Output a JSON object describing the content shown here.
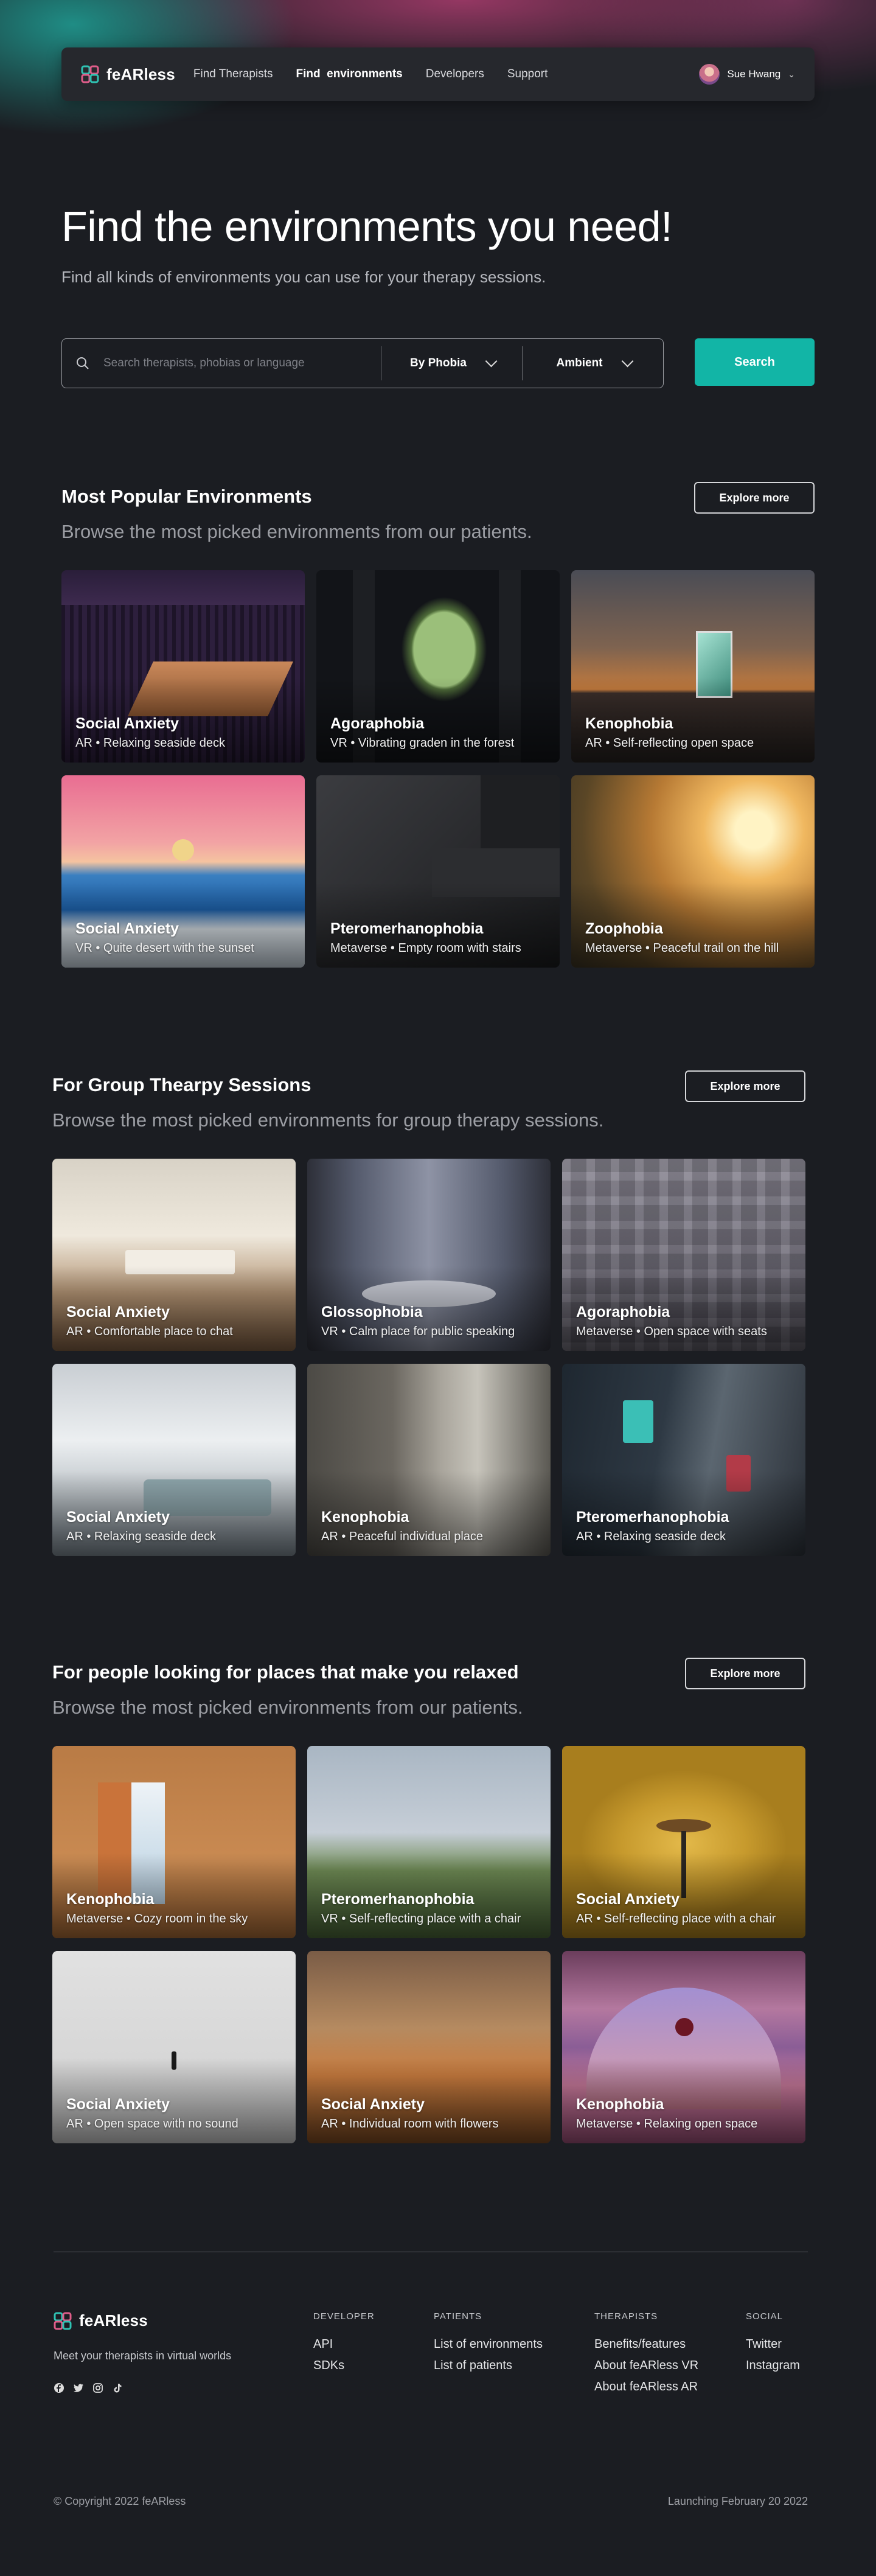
{
  "brand": {
    "name": "feARless",
    "accent": "#12b5a6"
  },
  "nav": {
    "links": [
      "Find Therapists",
      "Find  environments",
      "Developers",
      "Support"
    ],
    "active_index": 1,
    "user_name": "Sue Hwang",
    "user_chevron": "⌄"
  },
  "hero": {
    "title": "Find the environments you need!",
    "subtitle": "Find all kinds of environments you can use for your therapy sessions."
  },
  "search": {
    "placeholder": "Search therapists, phobias or language",
    "filter_phobia": "By Phobia",
    "filter_ambient": "Ambient",
    "button": "Search"
  },
  "sections": [
    {
      "title": "Most Popular Environments",
      "subtitle": "Browse the most picked environments from our patients.",
      "button": "Explore more",
      "cards": [
        {
          "title": "Social Anxiety",
          "meta": "AR • Relaxing seaside deck"
        },
        {
          "title": "Agoraphobia",
          "meta": "VR • Vibrating graden in the forest"
        },
        {
          "title": "Kenophobia",
          "meta": "AR • Self-reflecting open space"
        },
        {
          "title": "Social Anxiety",
          "meta": "VR • Quite desert with the sunset"
        },
        {
          "title": "Pteromerhanophobia",
          "meta": "Metaverse • Empty room with stairs"
        },
        {
          "title": "Zoophobia",
          "meta": "Metaverse • Peaceful trail on the hill"
        }
      ]
    },
    {
      "title": "For Group Thearpy Sessions",
      "subtitle": "Browse the most picked environments for group therapy sessions.",
      "button": "Explore more",
      "cards": [
        {
          "title": "Social Anxiety",
          "meta": "AR • Comfortable place to chat"
        },
        {
          "title": "Glossophobia",
          "meta": "VR • Calm place for public speaking"
        },
        {
          "title": "Agoraphobia",
          "meta": "Metaverse • Open space with seats"
        },
        {
          "title": "Social Anxiety",
          "meta": "AR • Relaxing seaside deck"
        },
        {
          "title": "Kenophobia",
          "meta": "AR • Peaceful individual place"
        },
        {
          "title": "Pteromerhanophobia",
          "meta": "AR • Relaxing seaside deck"
        }
      ]
    },
    {
      "title": "For people looking for places that make you relaxed",
      "subtitle": "Browse the most picked environments from our patients.",
      "button": "Explore more",
      "cards": [
        {
          "title": "Kenophobia",
          "meta": "Metaverse • Cozy room in the sky"
        },
        {
          "title": "Pteromerhanophobia",
          "meta": "VR • Self-reflecting place with a chair"
        },
        {
          "title": "Social Anxiety",
          "meta": "AR • Self-reflecting place with a chair"
        },
        {
          "title": "Social Anxiety",
          "meta": "AR •  Open space with no sound"
        },
        {
          "title": "Social Anxiety",
          "meta": "AR • Individual room with flowers"
        },
        {
          "title": "Kenophobia",
          "meta": "Metaverse • Relaxing open space"
        }
      ]
    }
  ],
  "footer": {
    "tagline": "Meet your therapists in virtual worlds",
    "social_icons": [
      "facebook-icon",
      "twitter-icon",
      "instagram-icon",
      "tiktok-icon"
    ],
    "columns": [
      {
        "heading": "DEVELOPER",
        "links": [
          "API",
          "SDKs"
        ]
      },
      {
        "heading": "PATIENTS",
        "links": [
          "List of environments",
          "List of patients"
        ]
      },
      {
        "heading": "THERAPISTS",
        "links": [
          "Benefits/features",
          "About feARless VR",
          "About feARless AR"
        ]
      },
      {
        "heading": "SOCIAL",
        "links": [
          "Twitter",
          "Instagram"
        ]
      }
    ],
    "copyright": "© Copyright 2022 feARless",
    "launch": "Launching February 20 2022"
  }
}
